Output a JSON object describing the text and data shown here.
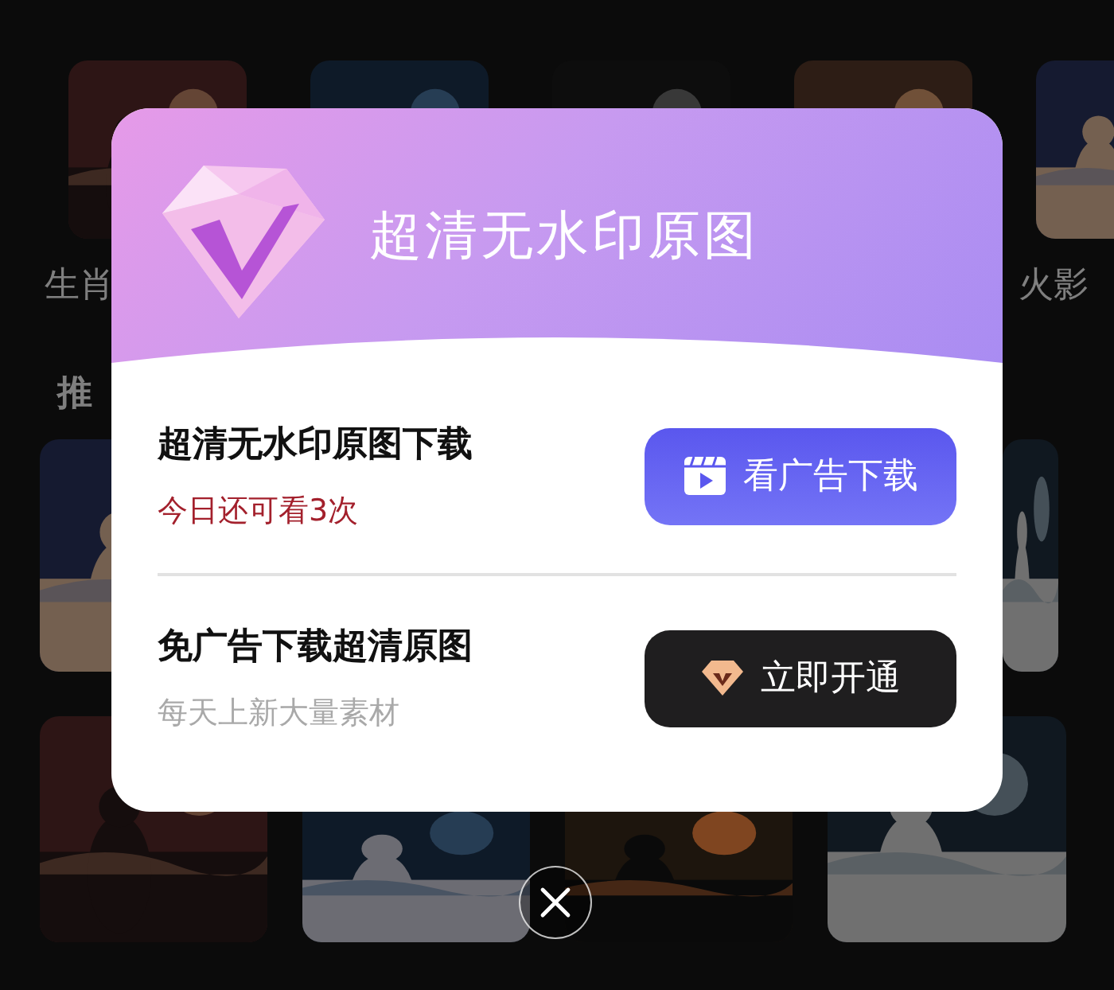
{
  "background": {
    "category_labels": [
      "生肖",
      "火影"
    ],
    "section_title": "推"
  },
  "dialog": {
    "banner_title": "超清无水印原图",
    "options": [
      {
        "title": "超清无水印原图下载",
        "subtitle": "今日还可看3次",
        "highlighted": true,
        "button": {
          "label": "看广告下载",
          "kind": "ad"
        }
      },
      {
        "title": "免广告下载超清原图",
        "subtitle": "每天上新大量素材",
        "highlighted": false,
        "button": {
          "label": "立即开通",
          "kind": "vip"
        }
      }
    ]
  }
}
